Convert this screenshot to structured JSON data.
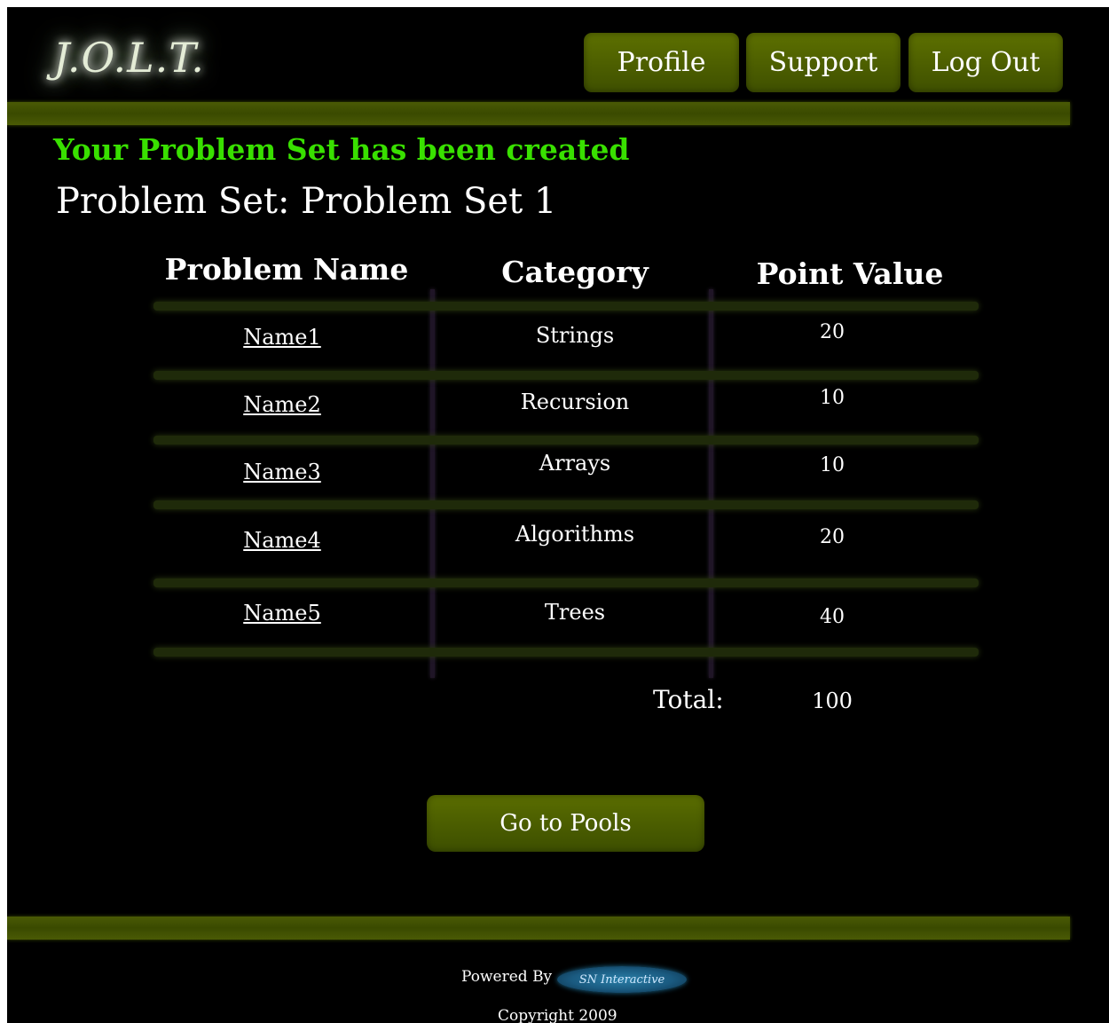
{
  "header": {
    "logo": "J.O.L.T.",
    "nav": {
      "profile": "Profile",
      "support": "Support",
      "logout": "Log Out"
    }
  },
  "main": {
    "success_message": "Your Problem Set has been created",
    "problem_set_title": "Problem Set: Problem Set 1",
    "table": {
      "columns": [
        "Problem Name",
        "Category",
        "Point Value"
      ],
      "rows": [
        {
          "name": "Name1",
          "category": "Strings",
          "points": "20"
        },
        {
          "name": "Name2",
          "category": "Recursion",
          "points": "10"
        },
        {
          "name": "Name3",
          "category": "Arrays",
          "points": "10"
        },
        {
          "name": "Name4",
          "category": "Algorithms",
          "points": "20"
        },
        {
          "name": "Name5",
          "category": "Trees",
          "points": "40"
        }
      ],
      "total_label": "Total:",
      "total_value": "100"
    },
    "go_button": "Go to Pools"
  },
  "footer": {
    "powered_by": "Powered By",
    "brand_logo": "SN Interactive",
    "copyright": "Copyright 2009"
  },
  "colors": {
    "background": "#000000",
    "accent_olive": "#4f6200",
    "success_green": "#39e000"
  }
}
